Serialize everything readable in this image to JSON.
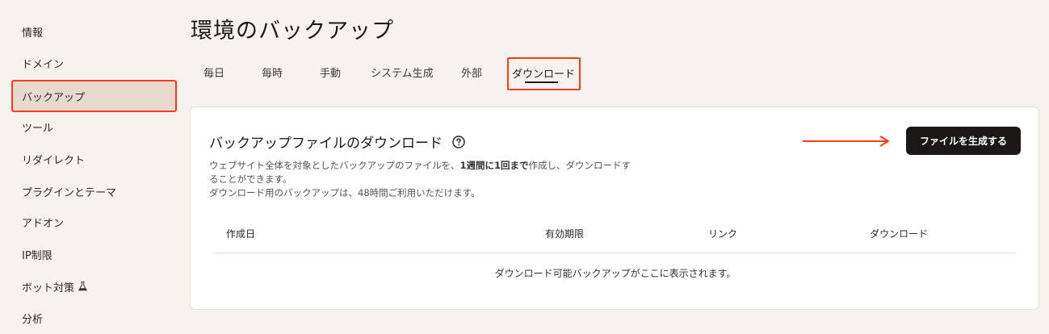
{
  "sidebar": {
    "items": [
      {
        "label": "情報"
      },
      {
        "label": "ドメイン"
      },
      {
        "label": "バックアップ"
      },
      {
        "label": "ツール"
      },
      {
        "label": "リダイレクト"
      },
      {
        "label": "プラグインとテーマ"
      },
      {
        "label": "アドオン"
      },
      {
        "label": "IP制限"
      },
      {
        "label": "ボット対策",
        "icon": "flask-icon"
      },
      {
        "label": "分析"
      }
    ],
    "active_index": 2
  },
  "header": {
    "title": "環境のバックアップ"
  },
  "tabs": [
    {
      "label": "毎日"
    },
    {
      "label": "毎時"
    },
    {
      "label": "手動"
    },
    {
      "label": "システム生成"
    },
    {
      "label": "外部"
    },
    {
      "label": "ダウンロード"
    }
  ],
  "active_tab": 5,
  "card": {
    "title": "バックアップファイルのダウンロード",
    "help_icon": "help-circle-icon",
    "description": {
      "line1_before": "ウェブサイト全体を対象としたバックアップのファイルを、",
      "line1_bold": "1週間に1回まで",
      "line1_after": "作成し、ダウンロードす",
      "line2": "ることができます。",
      "line3": "ダウンロード用のバックアップは、48時間ご利用いただけます。"
    },
    "generate_button": "ファイルを生成する",
    "table": {
      "columns": [
        "作成日",
        "有効期限",
        "リンク",
        "ダウンロード"
      ],
      "empty_message": "ダウンロード可能バックアップがここに表示されます。"
    }
  },
  "colors": {
    "background": "#f8f2ef",
    "highlight": "#ff3c14",
    "button": "#1c1717",
    "active_sidebar": "#e8d9d0"
  }
}
